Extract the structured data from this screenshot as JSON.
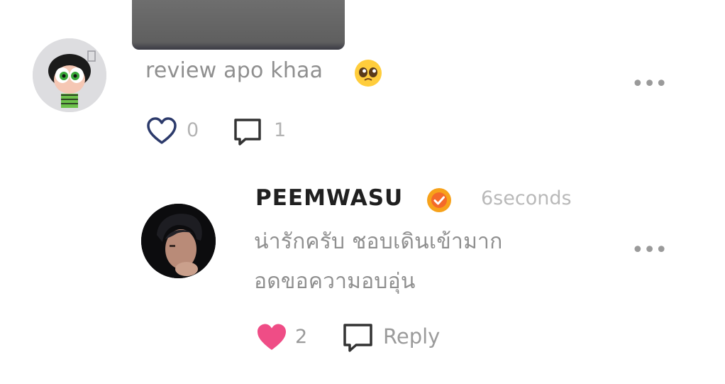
{
  "comment": {
    "avatar_icon": "powerpuff-buttercup-avatar",
    "text": "review apo khaa",
    "emoji_icon": "pleading-face-emoji",
    "more_label": "•••",
    "likes": "0",
    "replies": "1"
  },
  "reply": {
    "avatar_icon": "user-photo-avatar",
    "username": "PEEMWASU",
    "verified_icon": "verified-badge-icon",
    "timestamp": "6seconds",
    "text_line1": "น่ารักครับ ชอบเดินเข้ามาก",
    "text_line2": "อดขอความอบอุ่น",
    "more_label": "•••",
    "likes": "2",
    "reply_label": "Reply"
  },
  "colors": {
    "like_active": "#ef4d86",
    "like_outline": "#2c3a6b",
    "icon_dark": "#333333",
    "verified_badge": "#f7a21b"
  }
}
